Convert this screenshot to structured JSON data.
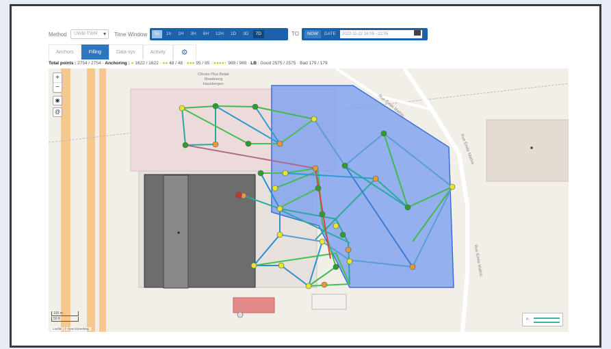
{
  "toolbar": {
    "method_label": "Method",
    "method_value": "UWB-TWR",
    "time_window_label": "Time Window",
    "time_buttons": [
      "5s",
      "1h",
      "1H",
      "3H",
      "6H",
      "12H",
      "1D",
      "3D",
      "7D"
    ],
    "to_label": "TO",
    "now_label": "NOW",
    "date_label": "DATE",
    "date_value": "2022-11-22 16:05 - 22:05"
  },
  "tabs": [
    "Anchors",
    "Filling",
    "Data-sys",
    "Activity"
  ],
  "stats": {
    "total_label": "Total points :",
    "total_value": "2754 / 2754",
    "anchoring_label": "Anchoring :",
    "anch_1": "1622 / 1622",
    "anch_2": "48 / 48",
    "anch_3": "95 / 95",
    "anch_4": "989 / 989",
    "lb_label": "LB",
    "good": "Good 2575 / 2575",
    "bad": "Bad 179 / 179"
  },
  "map": {
    "place_label": "Citroën Plus Retail\nStrasbourg\nHausbergen",
    "road_1": "Rue Émile Mathis",
    "road_2": "Rue Émile Mathis",
    "road_3": "Rue Émile Mathis",
    "scale_1": "100 m",
    "scale_2": "50 ft",
    "attribution": "Leaflet | © OpenStreetMap"
  },
  "icons": {
    "zoom_in": "plus-icon",
    "zoom_out": "minus-icon",
    "locate": "locate-icon",
    "layers": "layers-icon",
    "settings": "gear-icon",
    "calendar": "calendar-icon",
    "legend": "magnet-icon"
  },
  "colors": {
    "accent": "#1d62a8",
    "zone_fill": "#7da0f0",
    "anchor_green": "#2e9e2e",
    "anchor_yellow": "#e6e62a",
    "anchor_orange": "#e39a3a",
    "bad_marker": "#c0392b"
  }
}
